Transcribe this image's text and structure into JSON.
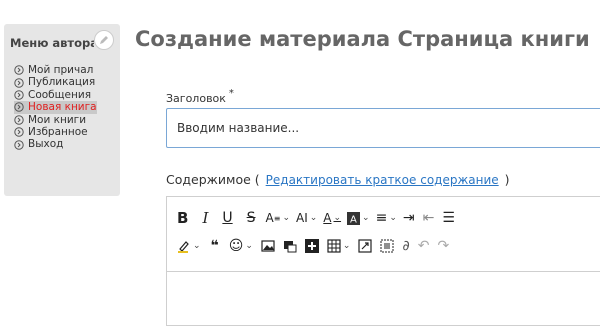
{
  "sidebar": {
    "title": "Меню автора",
    "items": [
      {
        "label": "Мой причал",
        "active": false
      },
      {
        "label": "Публикация",
        "active": false
      },
      {
        "label": "Сообщения",
        "active": false
      },
      {
        "label": "Новая книга",
        "active": true
      },
      {
        "label": "Мои книги",
        "active": false
      },
      {
        "label": "Избранное",
        "active": false
      },
      {
        "label": "Выход",
        "active": false
      }
    ]
  },
  "page_title": "Создание материала Страница книги",
  "form": {
    "title_label": "Заголовок",
    "required_mark": "*",
    "title_value": "Вводим название...",
    "content_label": "Содержимое (",
    "summary_link": "Редактировать краткое содержание",
    "content_label_close": ")"
  },
  "colors": {
    "active_item": "#e02020",
    "link": "#2a76c4",
    "input_border": "#7aa7d6"
  }
}
